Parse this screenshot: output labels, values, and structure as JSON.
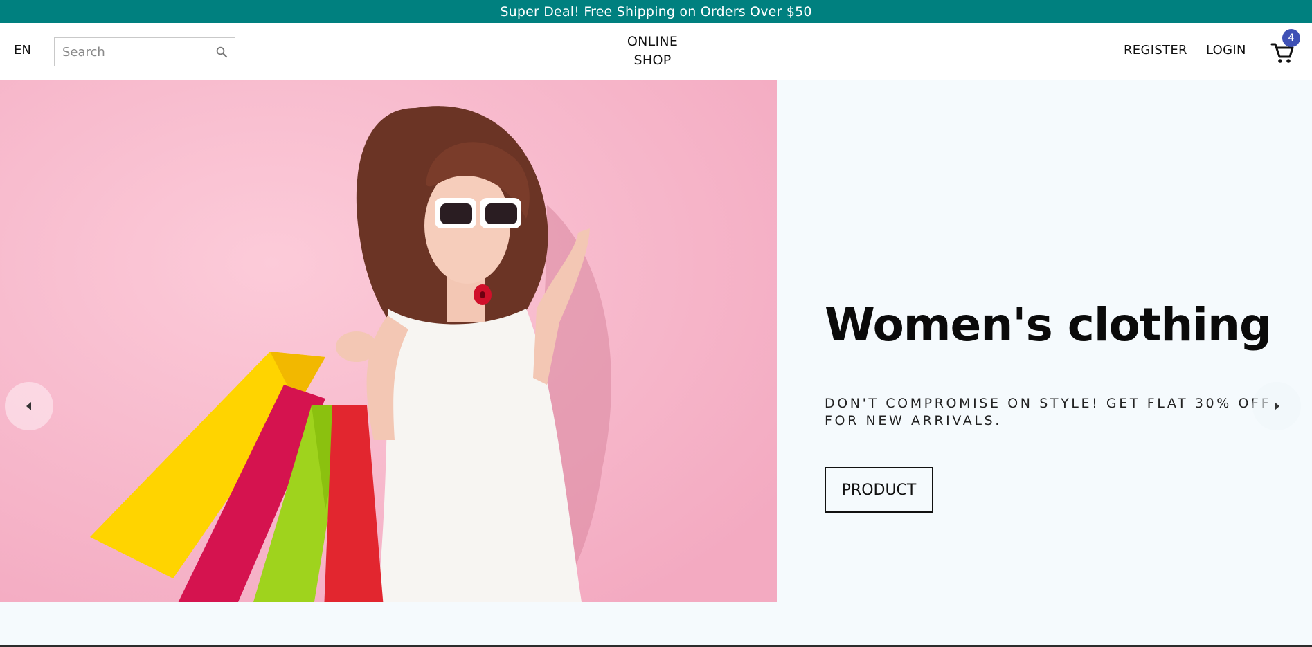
{
  "announcement": {
    "text": "Super Deal! Free Shipping on Orders Over $50"
  },
  "navbar": {
    "language": "EN",
    "search": {
      "placeholder": "Search",
      "value": ""
    },
    "logo": {
      "line1": "ONLINE",
      "line2": "SHOP"
    },
    "register_label": "REGISTER",
    "login_label": "LOGIN",
    "cart": {
      "count": "4",
      "icon": "shopping-cart-icon"
    }
  },
  "hero": {
    "title": "Women's clothing",
    "description": "DON'T COMPROMISE ON STYLE! GET FLAT 30% OFF FOR NEW ARRIVALS.",
    "button_label": "PRODUCT",
    "prev_icon": "chevron-left-icon",
    "next_icon": "chevron-right-icon"
  },
  "colors": {
    "announcement_bg": "#00807f",
    "badge_bg": "#3f51b5",
    "hero_bg": "#f5fafd",
    "image_bg": "#f6b9cc"
  }
}
